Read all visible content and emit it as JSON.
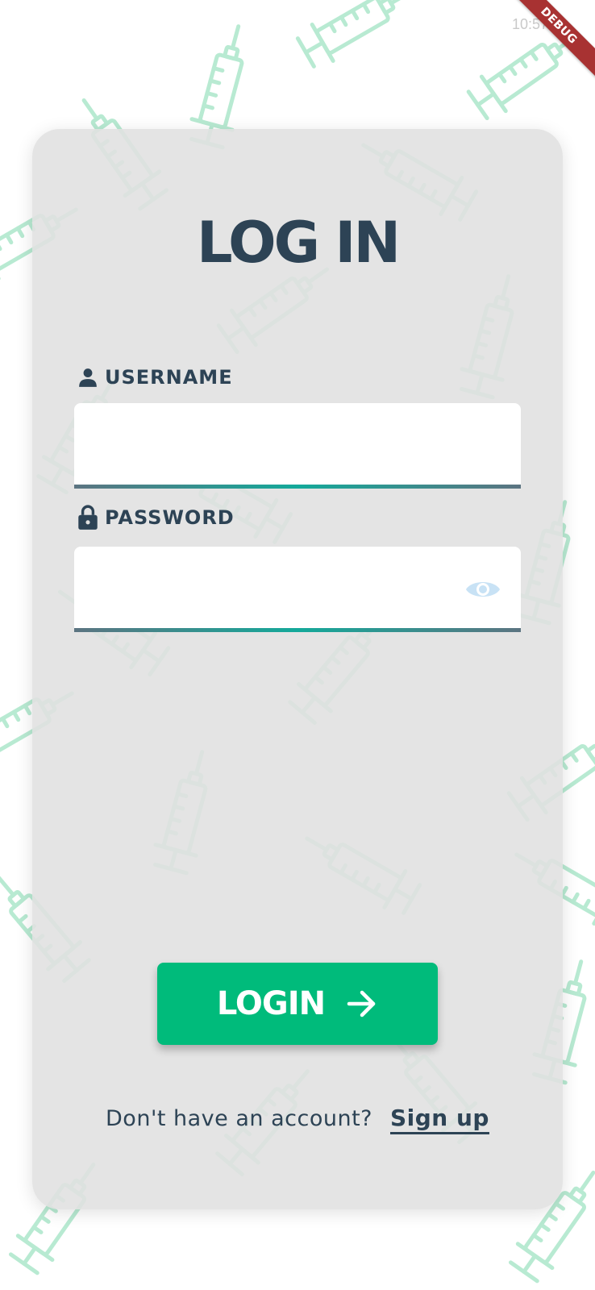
{
  "status_bar": {
    "time": "10:57"
  },
  "debug_banner": {
    "label": "DEBUG"
  },
  "login": {
    "title": "LOG IN",
    "username": {
      "label": "USERNAME",
      "value": "",
      "placeholder": "",
      "icon": "person-icon"
    },
    "password": {
      "label": "PASSWORD",
      "value": "",
      "placeholder": "",
      "icon": "lock-icon",
      "visibility_toggle_icon": "eye-icon"
    },
    "submit": {
      "label": "LOGIN",
      "icon": "arrow-right-icon"
    },
    "signup_prompt": {
      "question": "Don't have an account?",
      "link_label": "Sign up"
    }
  },
  "background": {
    "pattern_icon": "syringe-icon"
  },
  "colors": {
    "primary_text": "#2d4355",
    "accent_green": "#00bb7b",
    "pattern_green": "#b8ead2",
    "card_bg": "#e0e0e0",
    "input_underline": "#14a99a",
    "debug_banner": "#a83232"
  }
}
